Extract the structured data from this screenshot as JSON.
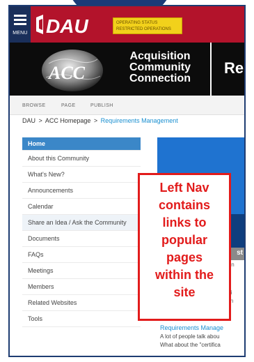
{
  "header": {
    "menu_label": "MENU",
    "logo_text": "DAU",
    "status_line1": "OPERATING STATUS",
    "status_line2": "RESTRICTED OPERATIONS"
  },
  "banner": {
    "logo_text": "ACC",
    "title_line1": "Acquisition",
    "title_line2": "Community",
    "title_line3": "Connection",
    "right_text": "Re"
  },
  "toolbar": {
    "browse": "BROWSE",
    "page": "PAGE",
    "publish": "PUBLISH"
  },
  "breadcrumb": {
    "item1": "DAU",
    "sep": ">",
    "item2": "ACC Homepage",
    "item3": "Requirements Management"
  },
  "leftnav": {
    "items": [
      "Home",
      "About this Community",
      "What's New?",
      "Announcements",
      "Calendar",
      "Share an Idea / Ask the Community",
      "Documents",
      "FAQs",
      "Meetings",
      "Members",
      "Related Websites",
      "Tools"
    ]
  },
  "content": {
    "tab_label": "st",
    "snippet1": "ssion",
    "snippet2": "quir",
    "snippet3": "sibili",
    "snippet4": "ust n",
    "req_link": "Requirements Manage",
    "req_text1": "A lot of people talk abou",
    "req_text2": "What about the \"certifica"
  },
  "callout": {
    "line1": "Left Nav",
    "line2": "contains",
    "line3": "links to",
    "line4": "popular",
    "line5": "pages",
    "line6": "within the",
    "line7": "site"
  },
  "colors": {
    "header_red": "#b3132b",
    "menu_navy": "#1a2f5a",
    "status_yellow": "#f2d11b",
    "nav_active": "#3b87c8",
    "link_blue": "#1a8fd0",
    "callout_red": "#e21b1b"
  }
}
